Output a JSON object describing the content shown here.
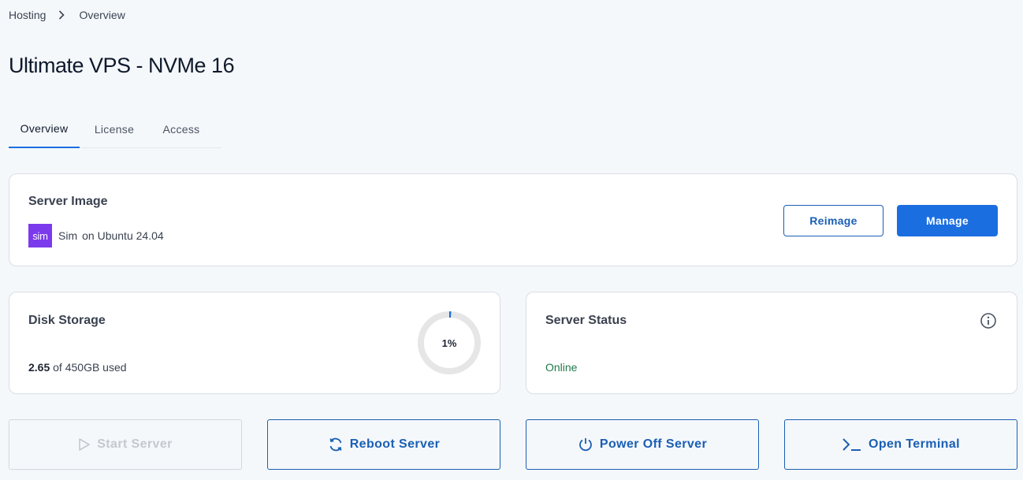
{
  "breadcrumb": {
    "items": [
      "Hosting",
      "Overview"
    ]
  },
  "page": {
    "title": "Ultimate VPS - NVMe 16"
  },
  "tabs": [
    {
      "label": "Overview",
      "active": true
    },
    {
      "label": "License",
      "active": false
    },
    {
      "label": "Access",
      "active": false
    }
  ],
  "server_image": {
    "title": "Server Image",
    "logo_text": "sim",
    "name": "Sim",
    "os": "on Ubuntu 24.04",
    "reimage_label": "Reimage",
    "manage_label": "Manage"
  },
  "disk": {
    "title": "Disk Storage",
    "used": "2.65",
    "total_text": "of 450GB used",
    "percent_label": "1%",
    "percent_value": 1
  },
  "status": {
    "title": "Server Status",
    "value": "Online"
  },
  "actions": {
    "start": "Start Server",
    "reboot": "Reboot Server",
    "power_off": "Power Off Server",
    "terminal": "Open Terminal"
  },
  "colors": {
    "accent": "#1a6ee0",
    "online": "#1e7a4a",
    "sim_logo": "#7c3aed",
    "background": "#f5f8fb"
  }
}
